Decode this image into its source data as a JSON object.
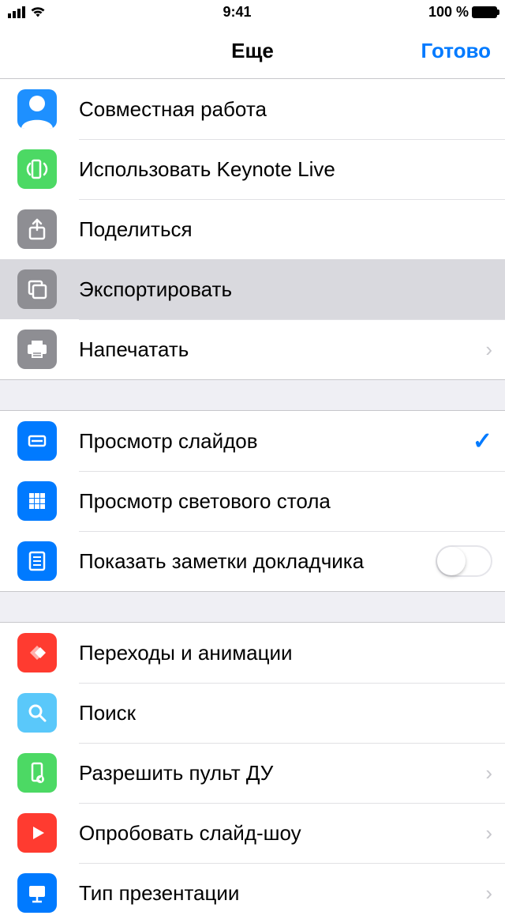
{
  "status": {
    "time": "9:41",
    "battery": "100 %"
  },
  "nav": {
    "title": "Еще",
    "done": "Готово"
  },
  "sections": [
    {
      "rows": [
        {
          "id": "collaborate",
          "label": "Совместная работа"
        },
        {
          "id": "keynote-live",
          "label": "Использовать Keynote Live"
        },
        {
          "id": "share",
          "label": "Поделиться"
        },
        {
          "id": "export",
          "label": "Экспортировать",
          "selected": true
        },
        {
          "id": "print",
          "label": "Напечатать",
          "chevron": true
        }
      ]
    },
    {
      "rows": [
        {
          "id": "slide-view",
          "label": "Просмотр слайдов",
          "checked": true
        },
        {
          "id": "light-table",
          "label": "Просмотр светового стола"
        },
        {
          "id": "presenter-notes",
          "label": "Показать заметки докладчика",
          "toggle": true,
          "toggle_on": false
        }
      ]
    },
    {
      "rows": [
        {
          "id": "transitions",
          "label": "Переходы и анимации"
        },
        {
          "id": "search",
          "label": "Поиск"
        },
        {
          "id": "remote",
          "label": "Разрешить пульт ДУ",
          "chevron": true
        },
        {
          "id": "rehearse",
          "label": "Опробовать слайд-шоу",
          "chevron": true
        },
        {
          "id": "presentation-type",
          "label": "Тип презентации",
          "chevron": true
        }
      ]
    }
  ]
}
